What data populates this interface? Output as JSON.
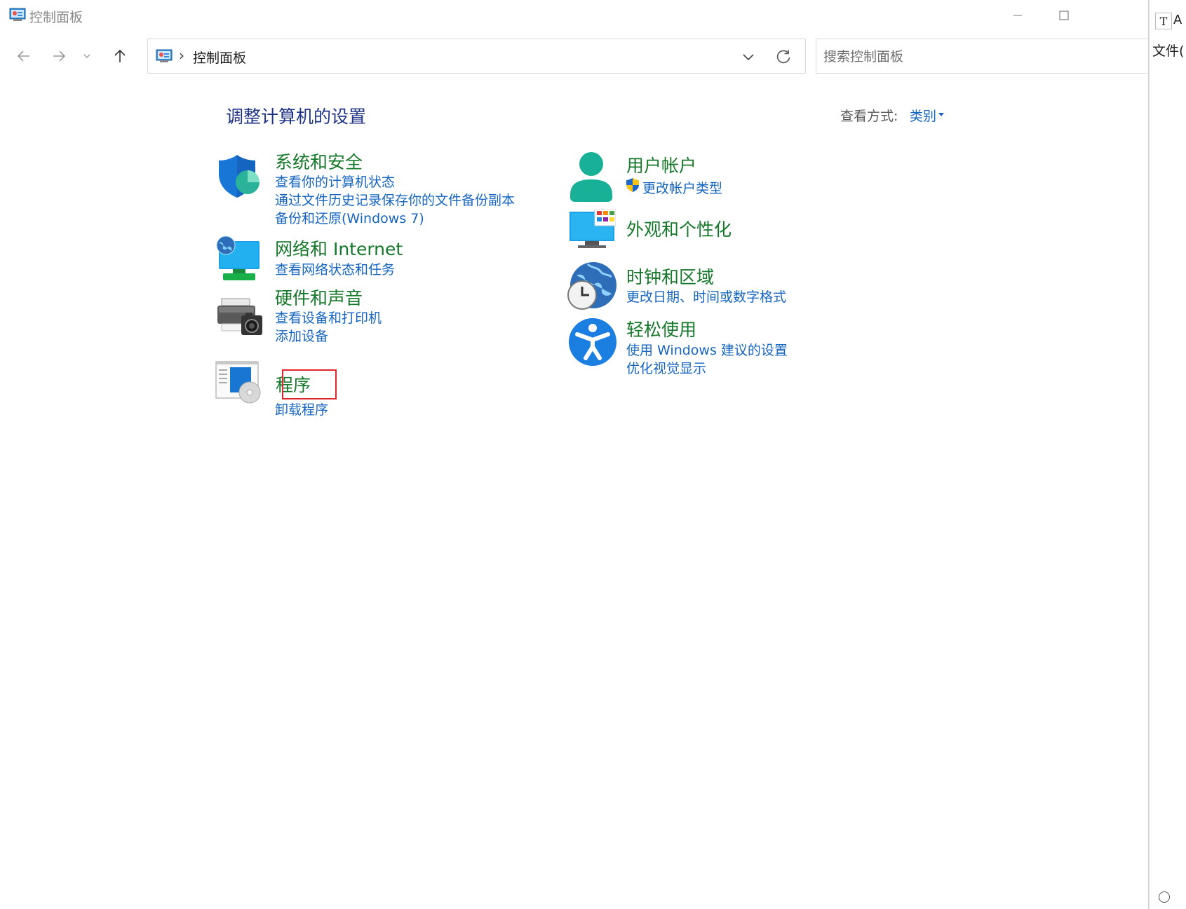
{
  "window": {
    "title": "控制面板"
  },
  "address": {
    "location": "控制面板"
  },
  "search": {
    "placeholder": "搜索控制面板"
  },
  "main": {
    "heading": "调整计算机的设置",
    "view_by_label": "查看方式:",
    "view_by_value": "类别"
  },
  "categories": {
    "system_security": {
      "title": "系统和安全",
      "links": [
        "查看你的计算机状态",
        "通过文件历史记录保存你的文件备份副本",
        "备份和还原(Windows 7)"
      ]
    },
    "network": {
      "title": "网络和 Internet",
      "links": [
        "查看网络状态和任务"
      ]
    },
    "hardware": {
      "title": "硬件和声音",
      "links": [
        "查看设备和打印机",
        "添加设备"
      ]
    },
    "programs": {
      "title": "程序",
      "links": [
        "卸载程序"
      ]
    },
    "user_accounts": {
      "title": "用户帐户",
      "links": [
        "更改帐户类型"
      ]
    },
    "appearance": {
      "title": "外观和个性化",
      "links": []
    },
    "clock_region": {
      "title": "时钟和区域",
      "links": [
        "更改日期、时间或数字格式"
      ]
    },
    "ease_of_access": {
      "title": "轻松使用",
      "links": [
        "使用 Windows 建议的设置",
        "优化视觉显示"
      ]
    }
  },
  "side_window": {
    "title_fragment": "A",
    "menu_fragment": "文件("
  },
  "colors": {
    "heading": "#1e3287",
    "category_title": "#16782a",
    "link": "#1565c0",
    "highlight": "#e0262a"
  }
}
